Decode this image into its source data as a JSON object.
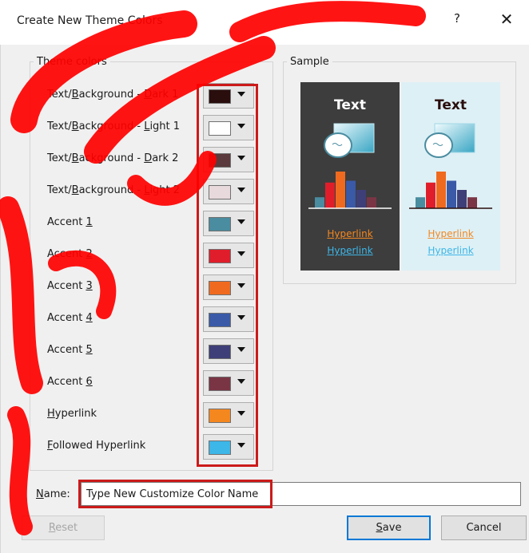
{
  "window": {
    "title": "Create New Theme Colors",
    "help_label": "?",
    "close_label": "✕"
  },
  "theme_colors": {
    "legend": "Theme colors",
    "rows": [
      {
        "pre": "Text/",
        "key": "B",
        "post": "ackground - ",
        "key2": "D",
        "post2": "ark 1",
        "color": "#2a0d0d"
      },
      {
        "pre": "Text/",
        "key": "B",
        "post": "ackground - ",
        "key2": "L",
        "post2": "ight 1",
        "color": "#ffffff"
      },
      {
        "pre": "Text/",
        "key": "B",
        "post": "ackground - ",
        "key2": "D",
        "post2": "ark 2",
        "color": "#5a3a3c"
      },
      {
        "pre": "Text/",
        "key": "B",
        "post": "ackground - ",
        "key2": "L",
        "post2": "ight 2",
        "color": "#e8d9dc"
      },
      {
        "pre": "Accent ",
        "key": "1",
        "post": "",
        "color": "#4a8ca0"
      },
      {
        "pre": "Accent ",
        "key": "2",
        "post": "",
        "color": "#e01e2b"
      },
      {
        "pre": "Accent ",
        "key": "3",
        "post": "",
        "color": "#ef6a1f"
      },
      {
        "pre": "Accent ",
        "key": "4",
        "post": "",
        "color": "#3a5aa8"
      },
      {
        "pre": "Accent ",
        "key": "5",
        "post": "",
        "color": "#3e3f78"
      },
      {
        "pre": "Accent ",
        "key": "6",
        "post": "",
        "color": "#7a3545"
      },
      {
        "pre": "",
        "key": "H",
        "post": "yperlink",
        "color": "#f5871f"
      },
      {
        "pre": "",
        "key": "F",
        "post": "ollowed Hyperlink",
        "color": "#3db6e8"
      }
    ]
  },
  "sample": {
    "legend": "Sample",
    "dark": {
      "title": "Text",
      "hyperlink": "Hyperlink",
      "followed": "Hyperlink"
    },
    "light": {
      "title": "Text",
      "hyperlink": "Hyperlink",
      "followed": "Hyperlink"
    },
    "bar_colors": [
      "#4a8ca0",
      "#e01e2b",
      "#ef6a1f",
      "#3a5aa8",
      "#3e3f78",
      "#7a3545"
    ],
    "bar_levels": [
      0.3,
      0.7,
      1.0,
      0.75,
      0.5,
      0.3
    ]
  },
  "name": {
    "label_key": "N",
    "label_rest": "ame:",
    "value": "Type New Customize Color Name"
  },
  "buttons": {
    "reset": {
      "key": "R",
      "rest": "eset"
    },
    "save": {
      "key": "S",
      "rest": "ave"
    },
    "cancel": {
      "label": "Cancel"
    }
  },
  "colors": {
    "highlight": "#cc1a1a",
    "focus": "#0078d7",
    "watermark": "#ff0000"
  }
}
